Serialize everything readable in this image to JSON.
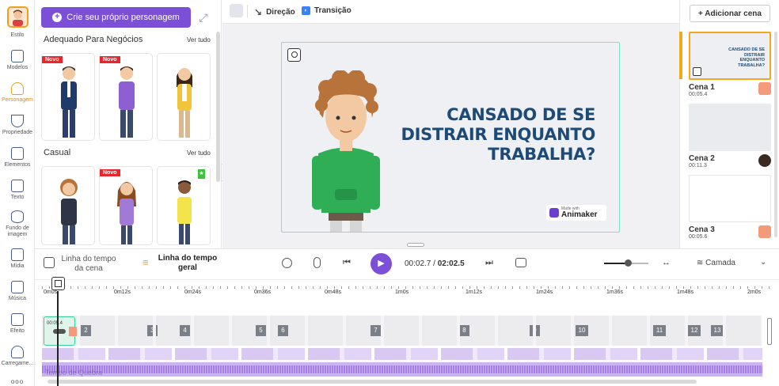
{
  "sidebar": {
    "items": [
      {
        "label": "Estilo",
        "icon": "style-icon",
        "active": false
      },
      {
        "label": "Modelos",
        "icon": "templates-icon",
        "active": false
      },
      {
        "label": "Personagem",
        "icon": "character-icon",
        "active": true
      },
      {
        "label": "Propriedade",
        "icon": "properties-icon",
        "active": false
      },
      {
        "label": "Elementos",
        "icon": "elements-icon",
        "active": false
      },
      {
        "label": "Texto",
        "icon": "text-icon",
        "active": false
      },
      {
        "label": "Fundo de imagem",
        "icon": "background-icon",
        "active": false
      },
      {
        "label": "Mídia",
        "icon": "media-icon",
        "active": false
      },
      {
        "label": "Música",
        "icon": "music-icon",
        "active": false
      },
      {
        "label": "Efeito",
        "icon": "effect-icon",
        "active": false
      },
      {
        "label": "Carregame...",
        "icon": "upload-icon",
        "active": false
      }
    ],
    "more": "ooo"
  },
  "character_panel": {
    "create_button": "Crie seu próprio personagem",
    "sections": [
      {
        "title": "Adequado Para Negócios",
        "see_all": "Ver tudo",
        "cards": [
          {
            "badge": "Novo"
          },
          {
            "badge": "Novo"
          },
          {
            "badge": ""
          }
        ]
      },
      {
        "title": "Casual",
        "see_all": "Ver tudo",
        "cards": [
          {
            "badge": ""
          },
          {
            "badge": "Novo"
          },
          {
            "badge": "star"
          }
        ]
      }
    ]
  },
  "toolbar": {
    "direction": "Direção",
    "transition": "Transição"
  },
  "canvas": {
    "headline": [
      "CANSADO DE SE",
      "DISTRAIR ENQUANTO",
      "TRABALHA?"
    ],
    "watermark_small": "Made with",
    "watermark_brand": "Animaker"
  },
  "scenes_panel": {
    "add_scene": "+ Adicionar cena",
    "scenes": [
      {
        "name": "Cena 1",
        "duration": "00:05.4",
        "thumb_text": "CANSADO DE SE DISTRAIR ENQUANTO TRABALHA?",
        "color": "#f49a7a"
      },
      {
        "name": "Cena 2",
        "duration": "00:11.3",
        "thumb_text": "",
        "color": "#3a2a22"
      },
      {
        "name": "Cena 3",
        "duration": "00:05.6",
        "thumb_text": "",
        "color": "#f49a7a"
      }
    ]
  },
  "playback": {
    "scene_timeline": "Linha do tempo da cena",
    "global_timeline": "Linha do tempo geral",
    "current_time": "00:02.7",
    "separator": "/",
    "total_time": "02:02.5",
    "layer": "Camada"
  },
  "timeline": {
    "ticks": [
      "0m0s",
      "0m12s",
      "0m24s",
      "0m36s",
      "0m48s",
      "1m0s",
      "1m12s",
      "1m24s",
      "1m36s",
      "1m48s",
      "2m0s"
    ],
    "first_segment_time": "00:05.4",
    "segments": [
      "2",
      "3",
      "4",
      "5",
      "6",
      "7",
      "8",
      "9",
      "10",
      "11",
      "12",
      "13"
    ],
    "audio_label": "Tempo de Quebra"
  },
  "colors": {
    "accent": "#7b4fd6",
    "highlight": "#f3a71c",
    "headline": "#1e4a78"
  }
}
